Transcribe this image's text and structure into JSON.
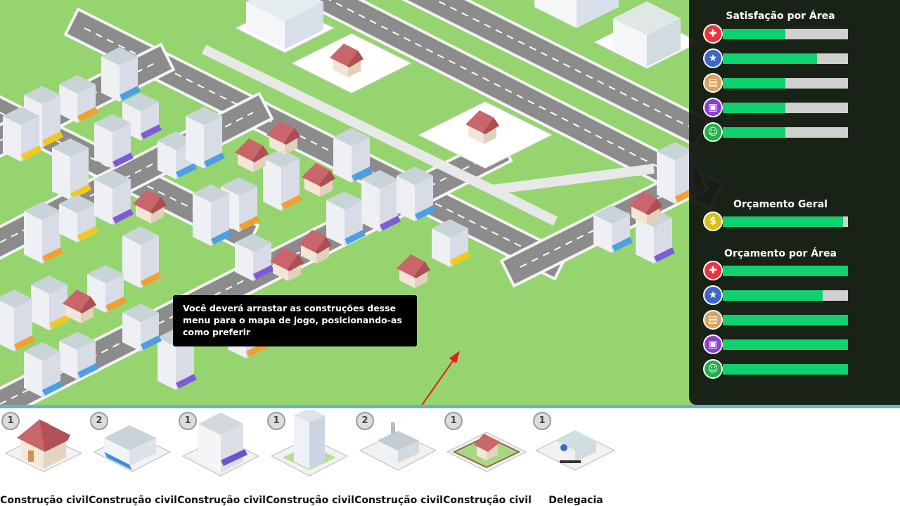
{
  "panel": {
    "satisfaction_title": "Satisfação por Área",
    "budget_general_title": "Orçamento Geral",
    "budget_area_title": "Orçamento por Área",
    "satisfaction": [
      {
        "area": "health",
        "icon": "health-cross-icon",
        "color": "#e8343e",
        "level": 0.5
      },
      {
        "area": "security",
        "icon": "police-badge-icon",
        "color": "#3c67c9",
        "level": 0.75
      },
      {
        "area": "education",
        "icon": "book-icon",
        "color": "#d8a45a",
        "level": 0.5
      },
      {
        "area": "transport",
        "icon": "bus-icon",
        "color": "#8b3fd0",
        "level": 0.5
      },
      {
        "area": "leisure",
        "icon": "smiley-icon",
        "color": "#22b04a",
        "level": 0.5
      }
    ],
    "budget_general": {
      "icon": "money-icon",
      "color": "#d8c00c",
      "symbol": "$",
      "level": 0.96
    },
    "budget_area": [
      {
        "area": "health",
        "icon": "health-cross-icon",
        "color": "#e8343e",
        "level": 1.0
      },
      {
        "area": "security",
        "icon": "police-badge-icon",
        "color": "#3c67c9",
        "level": 0.8
      },
      {
        "area": "education",
        "icon": "book-icon",
        "color": "#d8a45a",
        "level": 1.0
      },
      {
        "area": "transport",
        "icon": "bus-icon",
        "color": "#8b3fd0",
        "level": 1.0
      },
      {
        "area": "leisure",
        "icon": "smiley-icon",
        "color": "#22b04a",
        "level": 1.0
      }
    ]
  },
  "tooltip": {
    "text": "Você deverá arrastar as construções desse menu para o mapa de jogo, posicionando-as como preferir"
  },
  "build_menu": [
    {
      "name": "house",
      "count": "1",
      "label": "Construção civil"
    },
    {
      "name": "shop-blue-awning",
      "count": "2",
      "label": "Construção civil"
    },
    {
      "name": "apartment-purple-awning",
      "count": "1",
      "label": "Construção civil"
    },
    {
      "name": "tower",
      "count": "1",
      "label": "Construção civil"
    },
    {
      "name": "factory",
      "count": "2",
      "label": "Construção civil"
    },
    {
      "name": "fenced-house",
      "count": "1",
      "label": "Construção civil"
    },
    {
      "name": "police-station",
      "count": "1",
      "label": "Delegacia"
    }
  ],
  "colors": {
    "grass": "#96d46f",
    "road": "#8c8c8c",
    "panel_bg": "#0f140f",
    "meter_fill": "#0fd16f",
    "meter_track": "#d0d0d0",
    "menu_border": "#6fb0c4",
    "arrow": "#e81c1c"
  }
}
